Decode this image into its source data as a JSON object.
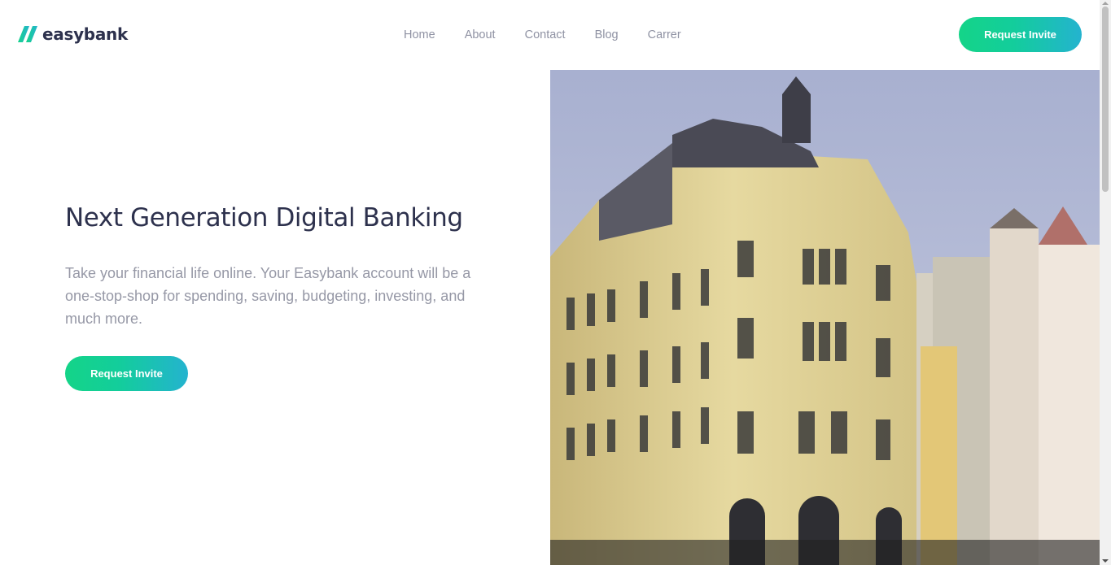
{
  "brand": {
    "name": "easybank"
  },
  "nav": {
    "items": [
      "Home",
      "About",
      "Contact",
      "Blog",
      "Carrer"
    ]
  },
  "header": {
    "cta_label": "Request Invite"
  },
  "hero": {
    "title": "Next Generation Digital Banking",
    "description": "Take your financial life online. Your Easybank account will be a one-stop-shop for spending, saving, budgeting, investing, and much more.",
    "cta_label": "Request Invite",
    "image_alt": "Ornate yellow corner building with rows of townhouses"
  },
  "colors": {
    "primary_text": "#2d314d",
    "muted_text": "#9698a6",
    "gradient_start": "#14d488",
    "gradient_end": "#24b3cf"
  },
  "icons": {
    "logo": "easybank-logo-icon"
  }
}
